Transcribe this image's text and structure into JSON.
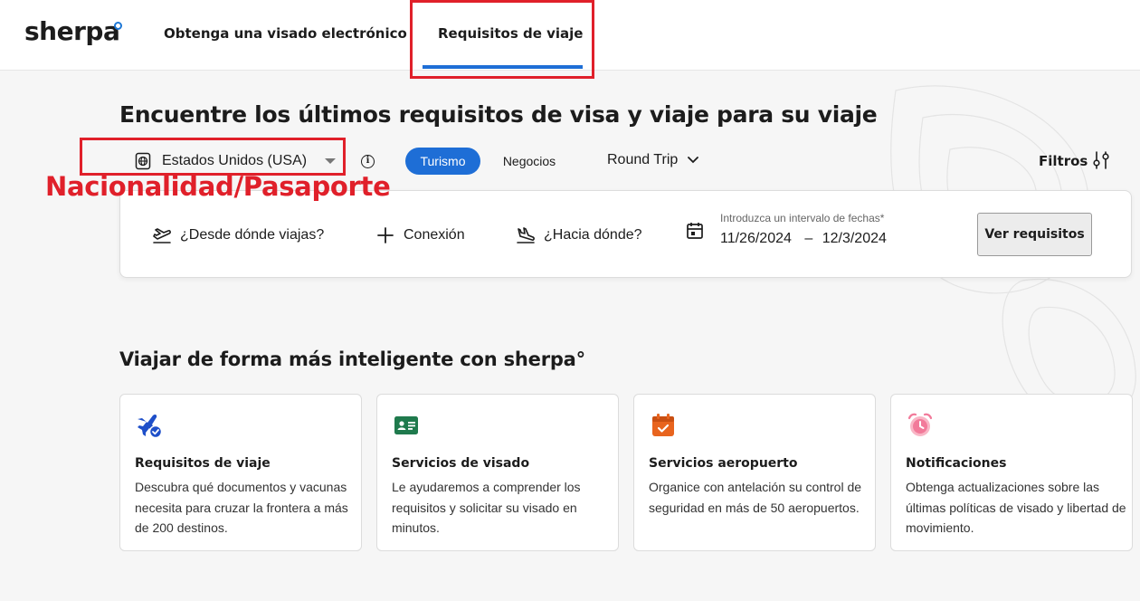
{
  "header": {
    "logo": "sherpa",
    "nav": [
      {
        "label": "Obtenga una visado electrónico"
      },
      {
        "label": "Requisitos de viaje",
        "active": true
      }
    ]
  },
  "annotation": {
    "label": "Nacionalidad/Pasaporte",
    "color": "#e0202a"
  },
  "hero": {
    "title": "Encuentre los últimos requisitos de visa y viaje para su viaje",
    "nationality": "Estados Unidos (USA)",
    "info_icon": "info-icon",
    "purpose_tabs": [
      {
        "label": "Turismo",
        "selected": true
      },
      {
        "label": "Negocios",
        "selected": false
      }
    ],
    "trip_type": "Round Trip",
    "filters_label": "Filtros"
  },
  "search": {
    "from_placeholder": "¿Desde dónde viajas?",
    "connection_label": "Conexión",
    "to_placeholder": "¿Hacia dónde?",
    "date_label": "Introduzca un intervalo de fechas*",
    "date_start": "11/26/2024",
    "date_separator": "–",
    "date_end": "12/3/2024",
    "submit_label": "Ver requisitos"
  },
  "features": {
    "title": "Viajar de forma más inteligente con sherpa°",
    "cards": [
      {
        "icon": "plane-check-icon",
        "title": "Requisitos de viaje",
        "desc": "Descubra qué documentos y vacunas necesita para cruzar la frontera a más de 200 destinos."
      },
      {
        "icon": "id-card-icon",
        "title": "Servicios de visado",
        "desc": "Le ayudaremos a comprender los requisitos y solicitar su visado en minutos."
      },
      {
        "icon": "calendar-check-icon",
        "title": "Servicios aeropuerto",
        "desc": "Organice con antelación su control de seguridad en más de 50 aeropuertos."
      },
      {
        "icon": "alarm-clock-icon",
        "title": "Notificaciones",
        "desc": "Obtenga actualizaciones sobre las últimas políticas de visado y libertad de movimiento."
      }
    ]
  },
  "colors": {
    "accent": "#1e6ed6",
    "annotation_red": "#e0202a",
    "id_card_green": "#1f7a4d",
    "calendar_orange": "#e8641e",
    "alarm_pink": "#f27a9a"
  }
}
